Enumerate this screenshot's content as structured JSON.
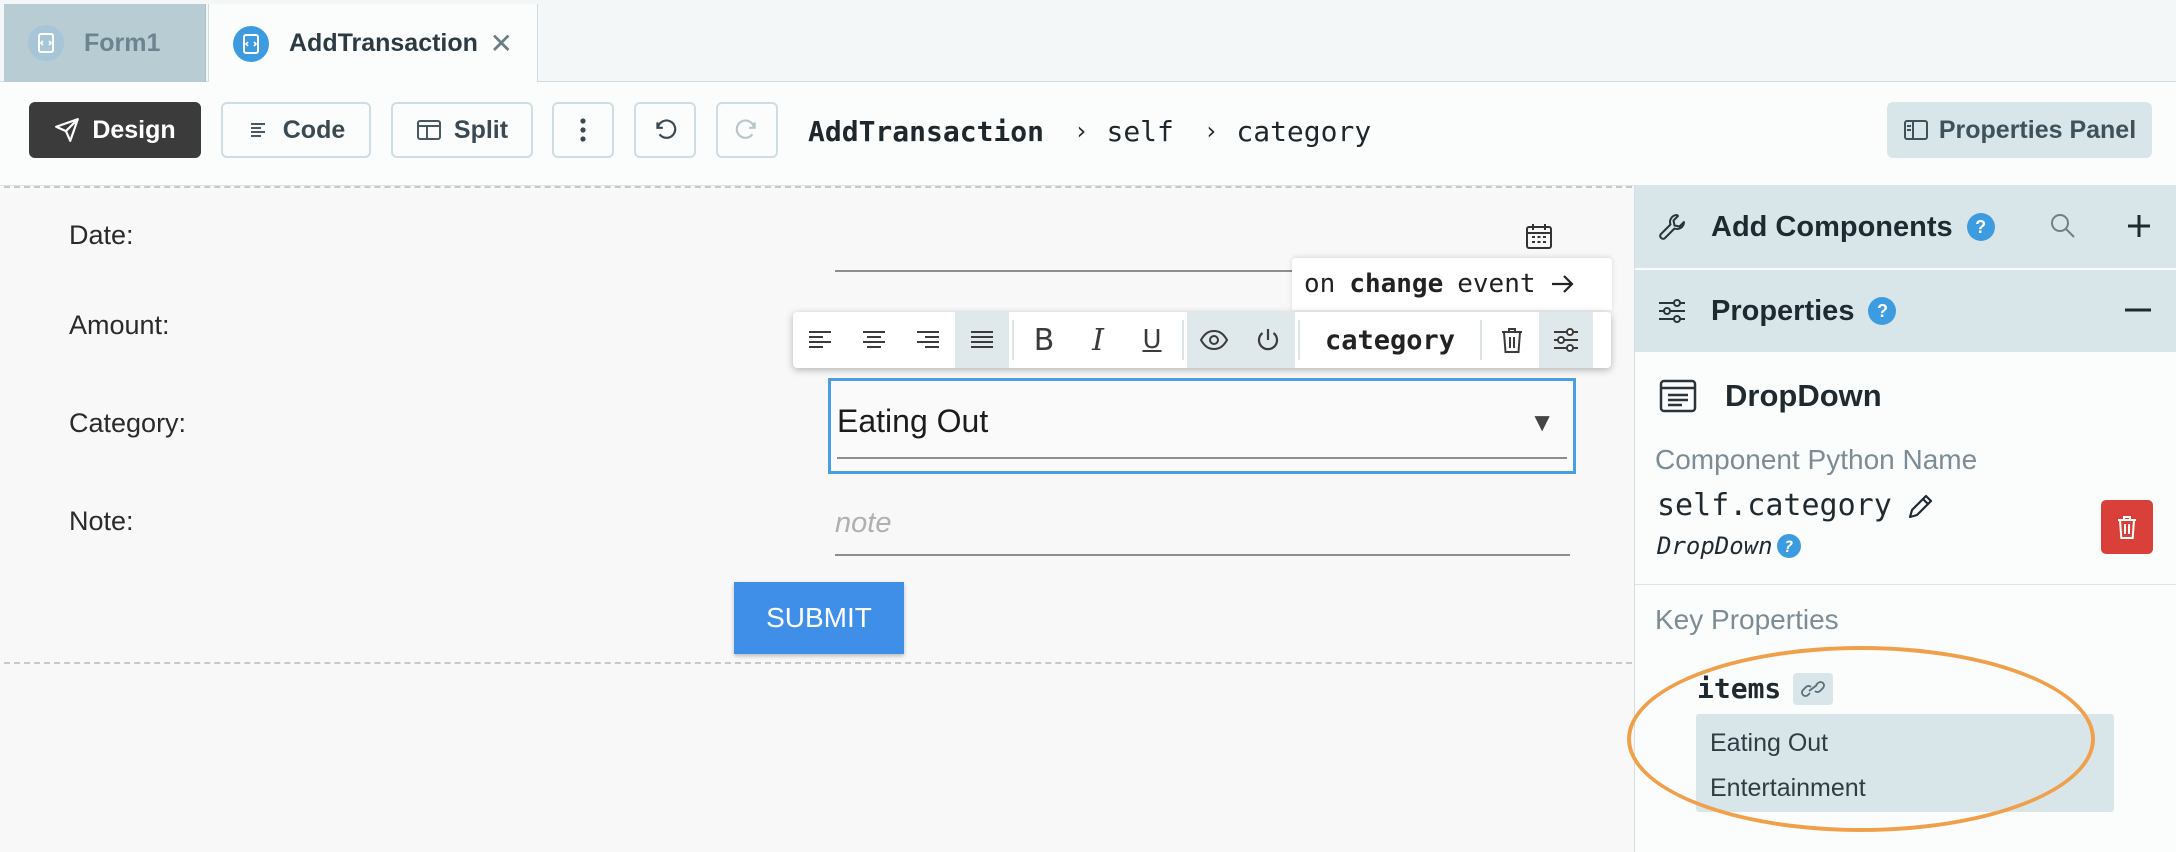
{
  "tabs": [
    {
      "label": "Form1",
      "active": false
    },
    {
      "label": "AddTransaction",
      "active": true
    }
  ],
  "toolbar": {
    "design_label": "Design",
    "code_label": "Code",
    "split_label": "Split",
    "properties_panel_label": "Properties Panel"
  },
  "breadcrumb": {
    "root": "AddTransaction",
    "parts": [
      "self",
      "category"
    ]
  },
  "form": {
    "date_label": "Date:",
    "amount_label": "Amount:",
    "category_label": "Category:",
    "note_label": "Note:",
    "category_value": "Eating Out",
    "note_placeholder": "note",
    "submit_label": "SUBMIT"
  },
  "floating_toolbar": {
    "event_prefix": "on",
    "event_name": "change",
    "event_suffix": "event",
    "component_name": "category",
    "bold_glyph": "B",
    "italic_glyph": "I",
    "underline_glyph": "U"
  },
  "panel": {
    "add_components_title": "Add Components",
    "properties_title": "Properties",
    "help_glyph": "?",
    "component_type": "DropDown",
    "python_name_label": "Component Python Name",
    "python_name": "self.category",
    "type_label": "DropDown",
    "key_properties_label": "Key Properties",
    "items_label": "items",
    "items": [
      "Eating Out",
      "Entertainment"
    ]
  },
  "colors": {
    "accent": "#3d9be0",
    "design_button": "#3b3b3b",
    "selected_outline": "#4a9fde",
    "submit": "#3f8fe9",
    "delete": "#d9403a",
    "highlight": "#f0a04b",
    "panel_header": "#d8e6ea"
  }
}
